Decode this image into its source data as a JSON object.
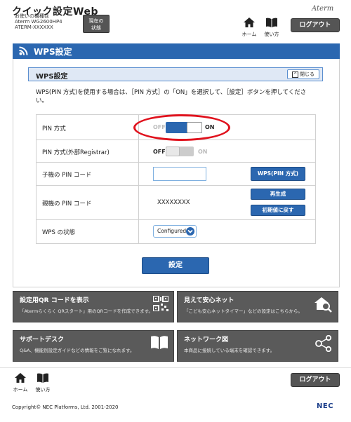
{
  "header": {
    "app_title": "クイック設定Web",
    "device_label": "お使いの機種は",
    "model": "Aterm WG2600HP4",
    "serial": "ATERM-XXXXXX",
    "status_button": [
      "現在の",
      "状態"
    ],
    "brand": "Aterm",
    "nav_home": "ホーム",
    "nav_help": "使い方",
    "logout": "ログアウト"
  },
  "page": {
    "title": "WPS設定"
  },
  "section": {
    "title": "WPS設定",
    "close_label": "閉じる",
    "description": "WPS(PIN 方式)を使用する場合は、［PIN 方式］の「ON」を選択して、［設定］ボタンを押してください。"
  },
  "settings": {
    "pin_method": {
      "label": "PIN 方式",
      "off": "OFF",
      "on": "ON",
      "state": "on"
    },
    "pin_method_external": {
      "label": "PIN 方式(外部Registrar)",
      "off": "OFF",
      "on": "ON",
      "state": "off"
    },
    "child_pin": {
      "label": "子機の PIN コード",
      "value": "",
      "button": "WPS(PIN 方式)"
    },
    "parent_pin": {
      "label": "親機の PIN コード",
      "value": "XXXXXXXX",
      "regenerate": "再生成",
      "reset_default": "初期値に戻す"
    },
    "wps_status": {
      "label": "WPS の状態",
      "selected": "Configured"
    }
  },
  "apply_button": "設定",
  "tiles": [
    {
      "title": "設定用QR コードを表示",
      "desc": "「Atermらくらく QRスタート」用のQRコードを作成できます。",
      "icon": "qr-code-icon"
    },
    {
      "title": "見えて安心ネット",
      "desc": "「こども安心ネットタイマー」などの設定はこちらから。",
      "icon": "home-search-icon"
    },
    {
      "title": "サポートデスク",
      "desc": "Q&A、機能別設定ガイドなどの情報をご覧になれます。",
      "icon": "book-icon"
    },
    {
      "title": "ネットワーク図",
      "desc": "本商品に接続している端末を確認できます。",
      "icon": "network-icon"
    }
  ],
  "footer": {
    "nav_home": "ホーム",
    "nav_help": "使い方",
    "logout": "ログアウト",
    "copyright": "Copyright© NEC Platforms, Ltd. 2001-2020",
    "brand": "NEC"
  },
  "colors": {
    "accent": "#2b67b0",
    "tile": "#5a5a5a",
    "annotation": "#e0121d"
  }
}
